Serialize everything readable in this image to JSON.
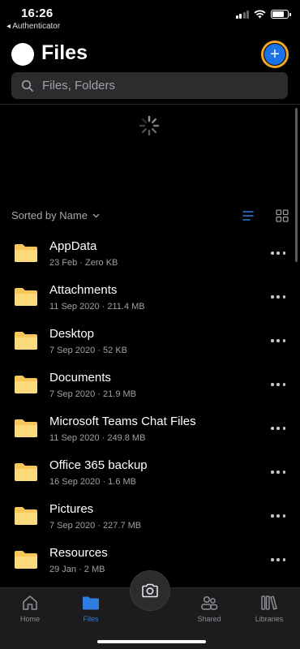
{
  "status": {
    "time": "16:26",
    "back_app": "◂ Authenticator"
  },
  "header": {
    "title": "Files",
    "add_symbol": "+"
  },
  "search": {
    "placeholder": "Files, Folders"
  },
  "sort": {
    "label": "Sorted by Name"
  },
  "files": [
    {
      "name": "AppData",
      "meta": "23 Feb · Zero KB"
    },
    {
      "name": "Attachments",
      "meta": "11 Sep 2020 · 211.4 MB"
    },
    {
      "name": "Desktop",
      "meta": "7 Sep 2020 · 52 KB"
    },
    {
      "name": "Documents",
      "meta": "7 Sep 2020 · 21.9 MB"
    },
    {
      "name": "Microsoft Teams Chat Files",
      "meta": "11 Sep 2020 · 249.8 MB"
    },
    {
      "name": "Office 365 backup",
      "meta": "16 Sep 2020 · 1.6 MB"
    },
    {
      "name": "Pictures",
      "meta": "7 Sep 2020 · 227.7 MB"
    },
    {
      "name": "Resources",
      "meta": "29 Jan · 2 MB"
    }
  ],
  "tabs": {
    "home": "Home",
    "files": "Files",
    "shared": "Shared",
    "libraries": "Libraries"
  },
  "colors": {
    "accent": "#2f7de1",
    "folder": "#f8c75a",
    "highlight": "#f5a623"
  },
  "icons": [
    "avatar",
    "plus-icon",
    "search-icon",
    "spinner-icon",
    "chevron-down-icon",
    "list-view-icon",
    "grid-view-icon",
    "folder-icon",
    "more-icon",
    "home-icon",
    "files-icon",
    "camera-icon",
    "shared-icon",
    "libraries-icon"
  ]
}
